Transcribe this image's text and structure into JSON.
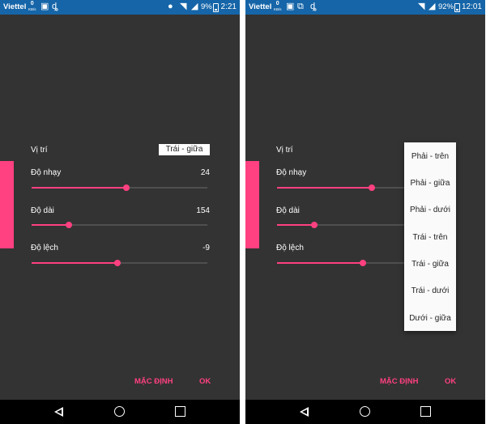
{
  "left": {
    "status": {
      "carrier": "Viettel",
      "kb_value": "0",
      "kb_unit": "KB/s",
      "battery": "9%",
      "time": "2:21"
    },
    "settings": {
      "position": {
        "label": "Vị trí",
        "value": "Trái - giữa"
      },
      "sensitivity": {
        "label": "Độ nhạy",
        "value": "24",
        "level": 0.54
      },
      "length": {
        "label": "Độ dài",
        "value": "154",
        "level": 0.21
      },
      "offset": {
        "label": "Độ lệch",
        "value": "-9",
        "level": 0.49
      }
    },
    "buttons": {
      "default": "MẶC ĐỊNH",
      "ok": "OK"
    }
  },
  "right": {
    "status": {
      "carrier": "Viettel",
      "kb_value": "0",
      "kb_unit": "KB/s",
      "battery": "92%",
      "time": "12:01"
    },
    "settings": {
      "position": {
        "label": "Vị trí"
      },
      "sensitivity": {
        "label": "Độ nhạy",
        "level": 0.54
      },
      "length": {
        "label": "Độ dài",
        "level": 0.21
      },
      "offset": {
        "label": "Độ lệch",
        "level": 0.49
      }
    },
    "dropdown_options": [
      "Phải - trên",
      "Phải - giữa",
      "Phải - dưới",
      "Trái - trên",
      "Trái - giữa",
      "Trái - dưới",
      "Dưới - giữa"
    ],
    "buttons": {
      "default": "MẶC ĐỊNH",
      "ok": "OK"
    }
  },
  "icons": {
    "status_left": [
      "image-icon",
      "app-notification-icon",
      "location-icon",
      "wifi-icon",
      "signal-icon",
      "battery-icon"
    ],
    "status_right": [
      "image-icon",
      "dual-sim-icon",
      "app-notification-icon",
      "wifi-icon",
      "signal-icon",
      "battery-icon"
    ],
    "nav": [
      "back-icon",
      "home-icon",
      "recents-icon"
    ]
  },
  "colors": {
    "accent": "#ff4081",
    "status_bar": "#1565a8",
    "background": "#333333",
    "dropdown": "#fafafa"
  }
}
